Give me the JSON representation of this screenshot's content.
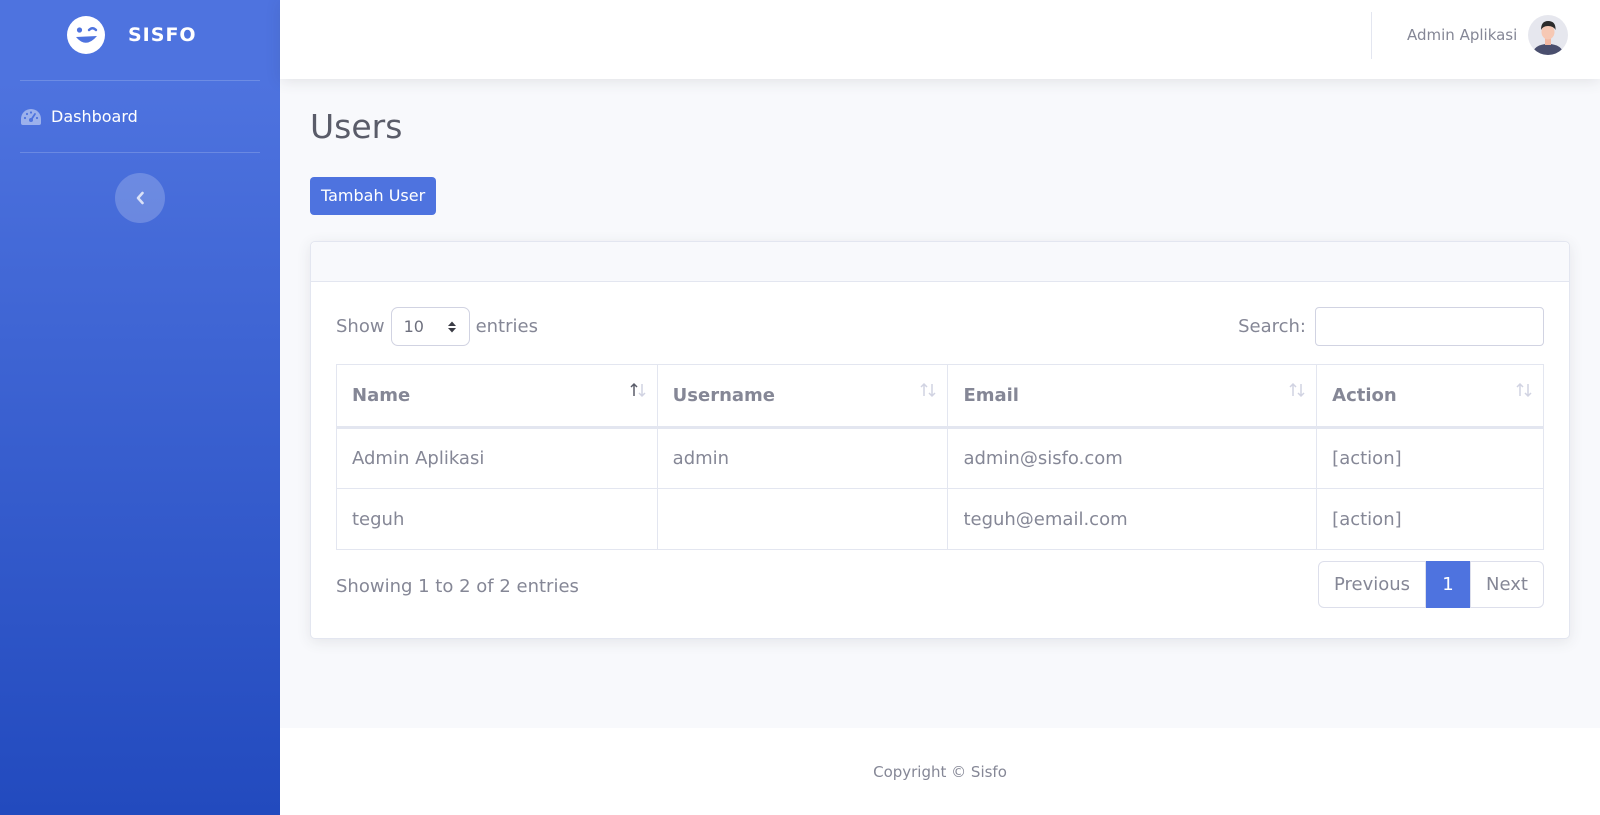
{
  "sidebar": {
    "brand": "SISFO",
    "items": [
      {
        "label": "Dashboard",
        "icon": "tachometer-icon"
      }
    ],
    "toggle_icon": "chevron-left-icon"
  },
  "topbar": {
    "user_name": "Admin Aplikasi",
    "avatar_icon": "user-avatar"
  },
  "page": {
    "title": "Users",
    "add_button": "Tambah User"
  },
  "table_controls": {
    "show_label": "Show",
    "entries_value": "10",
    "entries_label": "entries",
    "search_label": "Search:",
    "search_value": ""
  },
  "table": {
    "columns": [
      "Name",
      "Username",
      "Email",
      "Action"
    ],
    "rows": [
      [
        "Admin Aplikasi",
        "admin",
        "admin@sisfo.com",
        "[action]"
      ],
      [
        "teguh",
        "",
        "teguh@email.com",
        "[action]"
      ]
    ]
  },
  "pagination": {
    "info": "Showing 1 to 2 of 2 entries",
    "previous": "Previous",
    "current_page": "1",
    "next": "Next"
  },
  "footer": {
    "copyright": "Copyright © Sisfo"
  },
  "colors": {
    "primary": "#4e73df",
    "sidebar_bottom": "#224abe",
    "text_muted": "#858796",
    "heading": "#5a5c69"
  }
}
